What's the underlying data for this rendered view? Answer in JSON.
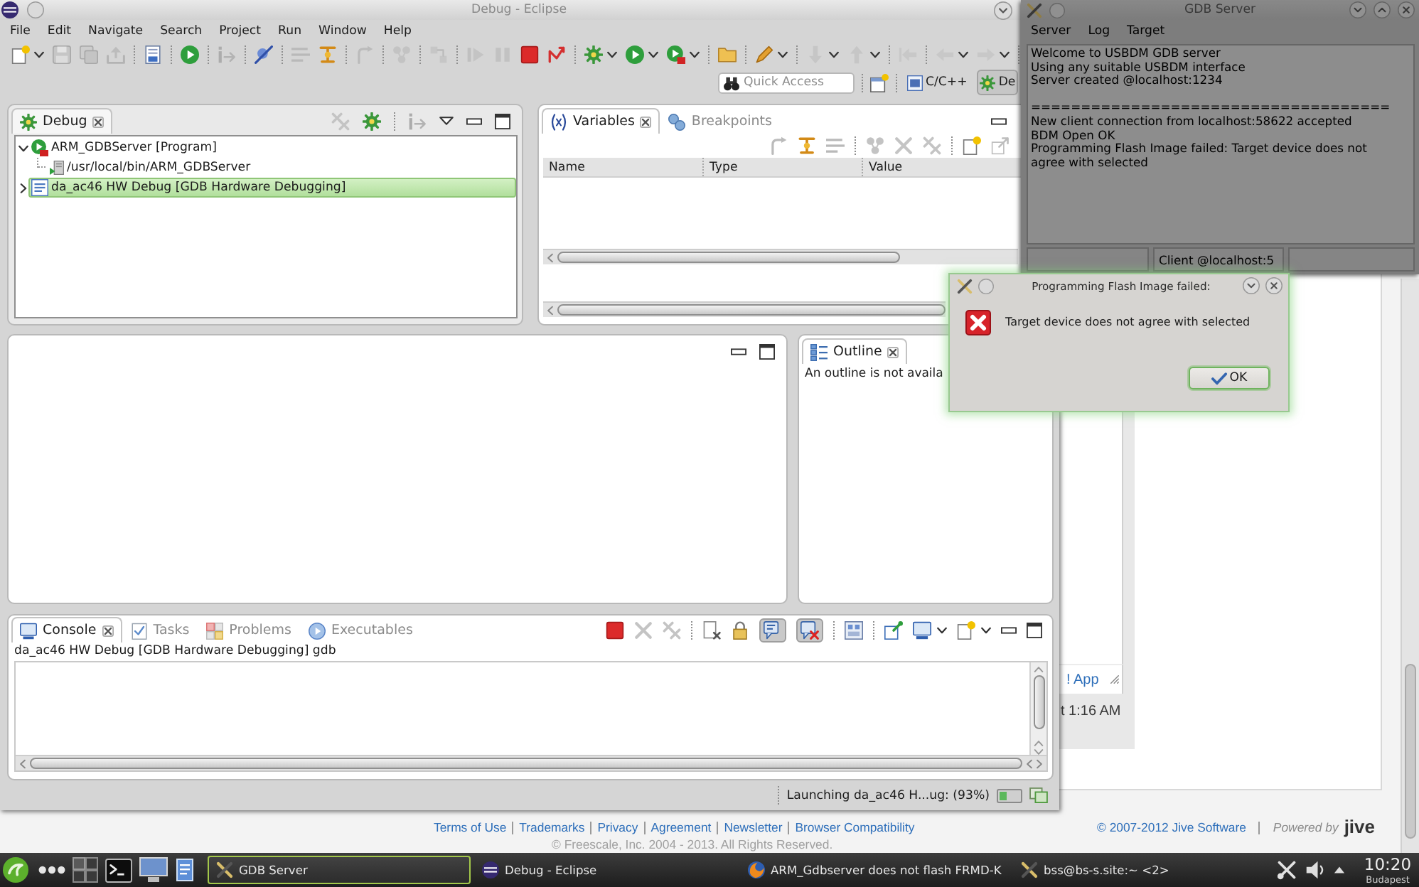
{
  "eclipse": {
    "title": "Debug - Eclipse",
    "menu": [
      "File",
      "Edit",
      "Navigate",
      "Search",
      "Project",
      "Run",
      "Window",
      "Help"
    ],
    "quick_access": {
      "placeholder": "Quick Access"
    },
    "perspectives": [
      {
        "label": "C/C++",
        "kind": "cpp",
        "selected": false
      },
      {
        "label": "De",
        "kind": "debug",
        "selected": true
      }
    ],
    "debug_view": {
      "tabs": [
        {
          "label": "Debug",
          "kind": "debug",
          "selected": true
        }
      ],
      "tree": [
        {
          "label": "ARM_GDBServer [Program]",
          "kind": "program",
          "expanded": true,
          "selected": false,
          "children": [
            {
              "label": "/usr/local/bin/ARM_GDBServer",
              "kind": "process",
              "selected": false
            }
          ]
        },
        {
          "label": "da_ac46 HW Debug [GDB Hardware Debugging]",
          "kind": "launch",
          "expanded": false,
          "selected": true
        }
      ]
    },
    "variables_view": {
      "tabs": [
        {
          "label": "Variables",
          "kind": "variables",
          "selected": true
        },
        {
          "label": "Breakpoints",
          "kind": "breakpoints",
          "selected": false
        }
      ],
      "columns": [
        "Name",
        "Type",
        "Value"
      ]
    },
    "outline_view": {
      "tabs": [
        {
          "label": "Outline",
          "kind": "outline",
          "selected": true
        }
      ],
      "message": "An outline is not availa"
    },
    "console_view": {
      "tabs": [
        {
          "label": "Console",
          "kind": "console",
          "selected": true
        },
        {
          "label": "Tasks",
          "kind": "tasks",
          "selected": false
        },
        {
          "label": "Problems",
          "kind": "problems",
          "selected": false
        },
        {
          "label": "Executables",
          "kind": "executables",
          "selected": false
        }
      ],
      "toggles": [
        {
          "on": true
        },
        {
          "on": true
        }
      ],
      "process": "da_ac46 HW Debug [GDB Hardware Debugging] gdb"
    },
    "status_bar": {
      "progress": "Launching da_ac46 H...ug: (93%)"
    }
  },
  "gdb_server": {
    "title": "GDB Server",
    "menu": [
      "Server",
      "Log",
      "Target"
    ],
    "log": [
      {
        "kind": "text",
        "text": "Welcome to USBDM GDB server"
      },
      {
        "kind": "text",
        "text": "Using any suitable USBDM interface"
      },
      {
        "kind": "text",
        "text": "Server created @localhost:1234"
      },
      {
        "kind": "separator",
        "text": "===================================="
      },
      {
        "kind": "text",
        "text": "New client connection from localhost:58622 accepted"
      },
      {
        "kind": "text",
        "text": "BDM Open OK"
      },
      {
        "kind": "text",
        "text": "Programming Flash Image failed: Target device does not agree with selected"
      }
    ],
    "status": "Client @localhost:5"
  },
  "dialog": {
    "title": "Programming Flash Image failed:",
    "message": "Target device does not agree with selected",
    "ok_button": {
      "label": "OK",
      "focused": true
    }
  },
  "web_page": {
    "link": "! App",
    "time": "t 1:16 AM",
    "footer_links": [
      "Terms of Use",
      "Trademarks",
      "Privacy",
      "Agreement",
      "Newsletter",
      "Browser Compatibility"
    ],
    "jive_copyright": "© 2007-2012 Jive Software",
    "powered_by": "Powered by",
    "logo": "jive",
    "copyright": "© Freescale, Inc. 2004 - 2013. All Rights Reserved."
  },
  "taskbar": {
    "tasks": [
      {
        "label": "GDB Server",
        "kind": "tool",
        "selected": true
      },
      {
        "label": "Debug - Eclipse",
        "kind": "ide",
        "selected": false
      },
      {
        "label": "ARM_Gdbserver does not flash FRMD-K",
        "kind": "browser",
        "selected": false
      },
      {
        "label": "bss@bs-s.site:~ <2>",
        "kind": "tool",
        "selected": false
      }
    ],
    "clock": {
      "time": "10:20",
      "place": "Budapest"
    }
  }
}
